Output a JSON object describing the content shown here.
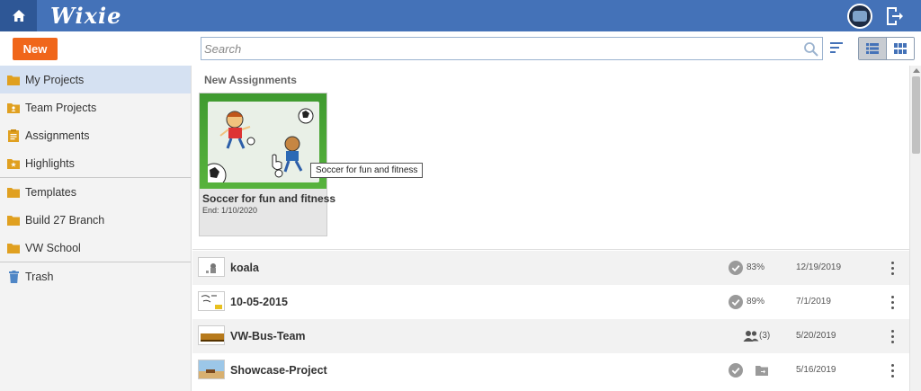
{
  "header": {
    "logo": "Wixie"
  },
  "toolbar": {
    "new_label": "New",
    "search_placeholder": "Search"
  },
  "sidebar": {
    "items": [
      {
        "label": "My Projects"
      },
      {
        "label": "Team Projects"
      },
      {
        "label": "Assignments"
      },
      {
        "label": "Highlights"
      },
      {
        "label": "Templates"
      },
      {
        "label": "Build 27 Branch"
      },
      {
        "label": "VW School"
      },
      {
        "label": "Trash"
      }
    ]
  },
  "assignments": {
    "title": "New Assignments",
    "card": {
      "title": "Soccer for fun and fitness",
      "end": "End: 1/10/2020",
      "tooltip": "Soccer for fun and fitness"
    }
  },
  "projects": [
    {
      "name": "koala",
      "score": "83%",
      "date": "12/19/2019"
    },
    {
      "name": "10-05-2015",
      "score": "89%",
      "date": "7/1/2019"
    },
    {
      "name": "VW-Bus-Team",
      "score": "(3)",
      "date": "5/20/2019"
    },
    {
      "name": "Showcase-Project",
      "score": "",
      "date": "5/16/2019"
    }
  ],
  "colors": {
    "header": "#4472b8",
    "accent": "#f0661a",
    "folder": "#e0a020"
  }
}
